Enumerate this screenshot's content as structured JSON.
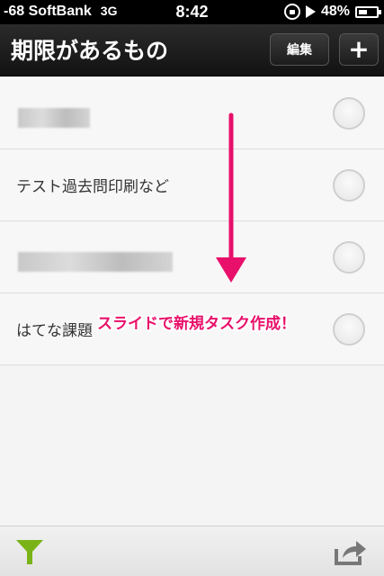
{
  "status_bar": {
    "carrier": "-68 SoftBank",
    "network": "3G",
    "time": "8:42",
    "battery": "48%",
    "icons": [
      "rotation-lock-icon",
      "play-icon",
      "battery-icon"
    ]
  },
  "nav_bar": {
    "title": "期限があるもの",
    "edit_label": "編集",
    "add_label": "+"
  },
  "tasks": [
    {
      "text": "",
      "blurred": true
    },
    {
      "text": "テスト過去問印刷など",
      "blurred": false
    },
    {
      "text": "",
      "blurred": true
    },
    {
      "text": "はてな課題",
      "blurred": false
    }
  ],
  "overlay": {
    "caption": "スライドで新規タスク作成！",
    "accent_color": "#e8106a"
  },
  "bottom_bar": {
    "icons": [
      "filter-icon",
      "share-icon"
    ],
    "filter_color": "#7ab317"
  }
}
